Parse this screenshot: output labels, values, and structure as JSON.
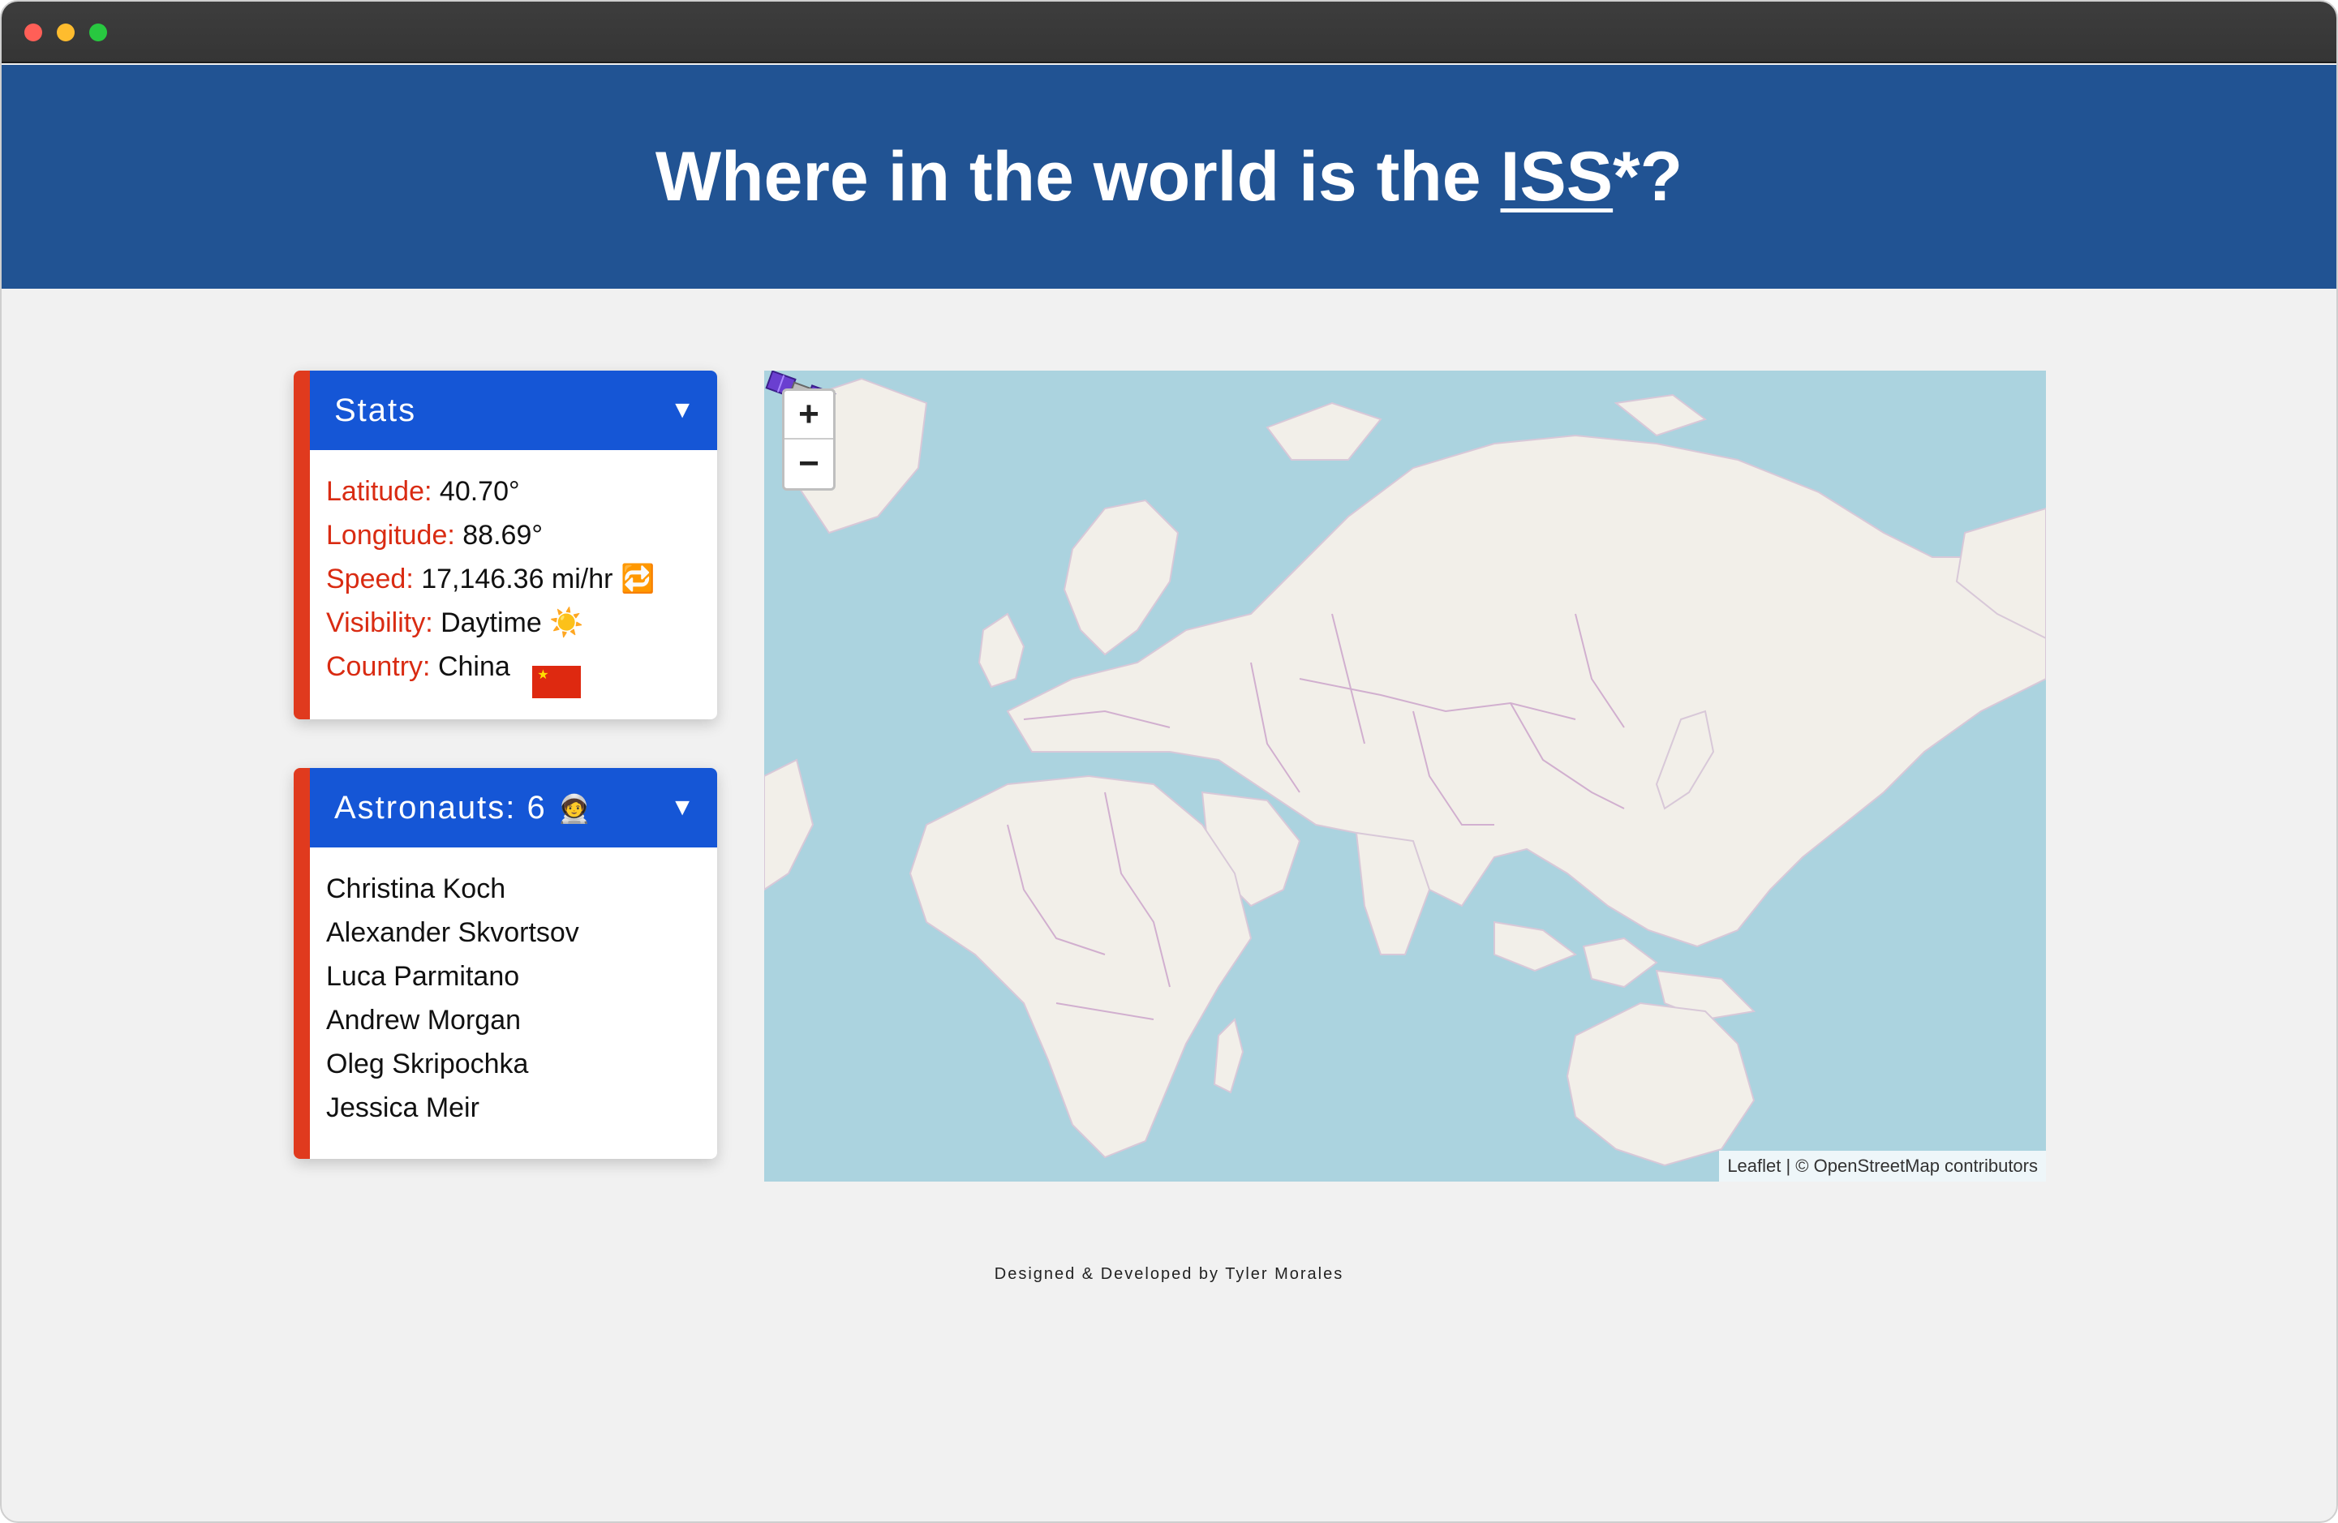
{
  "header": {
    "title_prefix": "Where in the world is the ",
    "title_link": "ISS",
    "title_suffix": "*?"
  },
  "stats": {
    "title": "Stats",
    "toggle": "▼",
    "rows": [
      {
        "label": "Latitude:",
        "value": "40.70°",
        "icon": ""
      },
      {
        "label": "Longitude:",
        "value": "88.69°",
        "icon": ""
      },
      {
        "label": "Speed:",
        "value": "17,146.36 mi/hr",
        "icon": "🔁"
      },
      {
        "label": "Visibility:",
        "value": "Daytime",
        "icon": "☀️"
      },
      {
        "label": "Country:",
        "value": "China",
        "icon": "flag-china"
      }
    ]
  },
  "astronauts": {
    "title": "Astronauts: 6",
    "title_icon": "🧑‍🚀",
    "toggle": "▼",
    "names": [
      "Christina Koch",
      "Alexander Skvortsov",
      "Luca Parmitano",
      "Andrew Morgan",
      "Oleg Skripochka",
      "Jessica Meir"
    ]
  },
  "map": {
    "zoom_in": "+",
    "zoom_out": "−",
    "attribution": "Leaflet | © OpenStreetMap contributors",
    "water_color": "#abd3df",
    "land_color": "#f2efe9",
    "border_color": "#c9a0c9",
    "marker_icon": "satellite-icon"
  },
  "footer": {
    "text": "Designed & Developed by Tyler Morales"
  }
}
